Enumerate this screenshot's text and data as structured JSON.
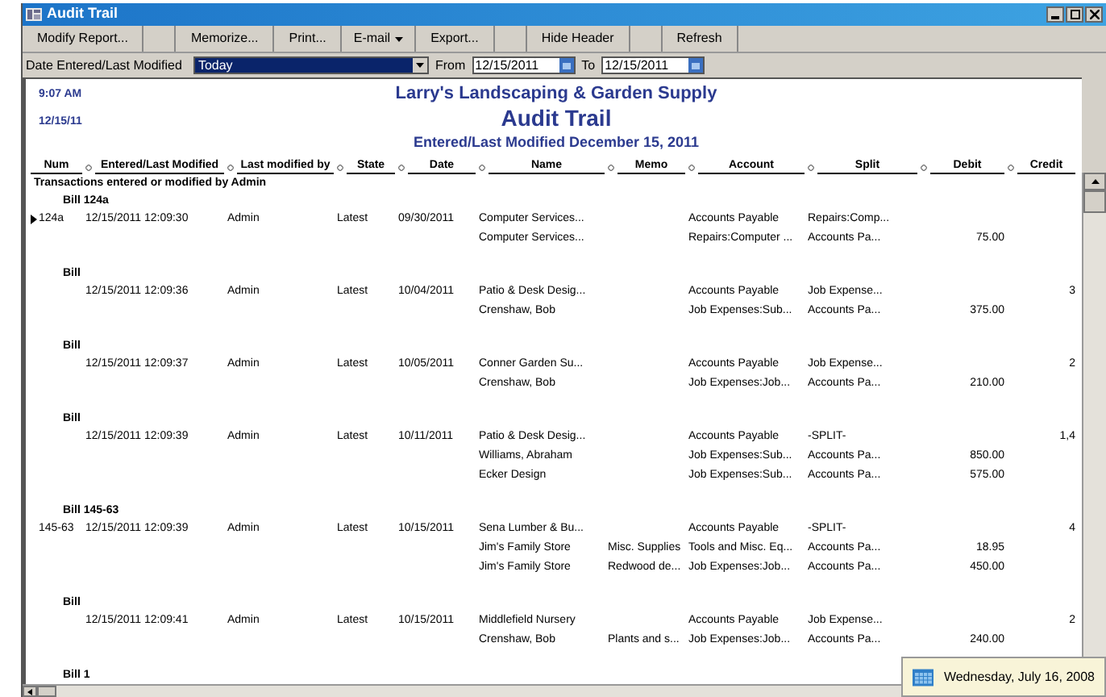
{
  "window": {
    "title": "Audit Trail"
  },
  "toolbar": [
    {
      "kind": "button",
      "label": "Modify Report..."
    },
    {
      "kind": "spacer"
    },
    {
      "kind": "button",
      "label": "Memorize..."
    },
    {
      "kind": "button",
      "label": "Print..."
    },
    {
      "kind": "menu",
      "label": "E-mail"
    },
    {
      "kind": "button",
      "label": "Export..."
    },
    {
      "kind": "spacer"
    },
    {
      "kind": "button",
      "label": "Hide Header"
    },
    {
      "kind": "spacer"
    },
    {
      "kind": "button",
      "label": "Refresh"
    }
  ],
  "filter": {
    "label": "Date Entered/Last Modified",
    "period": "Today",
    "from_label": "From",
    "from": "12/15/2011",
    "to_label": "To",
    "to": "12/15/2011"
  },
  "report": {
    "time": "9:07 AM",
    "date": "12/15/11",
    "company": "Larry's Landscaping & Garden Supply",
    "title": "Audit Trail",
    "subtitle": "Entered/Last Modified December 15, 2011",
    "columns": [
      "Num",
      "Entered/Last Modified",
      "Last modified by",
      "State",
      "Date",
      "Name",
      "Memo",
      "Account",
      "Split",
      "Debit",
      "Credit"
    ],
    "section": "Transactions entered or modified by Admin",
    "groups": [
      {
        "title": "Bill 124a",
        "lines": [
          {
            "selected": true,
            "num": "124a",
            "entered": "12/15/2011 12:09:30",
            "by": "Admin",
            "state": "Latest",
            "date": "09/30/2011",
            "name": "Computer Services...",
            "account": "Accounts Payable",
            "split": "Repairs:Comp..."
          },
          {
            "selected": false,
            "name": "Computer Services...",
            "account": "Repairs:Computer ...",
            "split": "Accounts Pa...",
            "debit": "75.00"
          }
        ]
      },
      {
        "title": "Bill",
        "lines": [
          {
            "selected": false,
            "entered": "12/15/2011 12:09:36",
            "by": "Admin",
            "state": "Latest",
            "date": "10/04/2011",
            "name": "Patio & Desk Desig...",
            "account": "Accounts Payable",
            "split": "Job Expense...",
            "credit": "3"
          },
          {
            "selected": false,
            "name": "Crenshaw, Bob",
            "account": "Job Expenses:Sub...",
            "split": "Accounts Pa...",
            "debit": "375.00"
          }
        ]
      },
      {
        "title": "Bill",
        "lines": [
          {
            "selected": false,
            "entered": "12/15/2011 12:09:37",
            "by": "Admin",
            "state": "Latest",
            "date": "10/05/2011",
            "name": "Conner Garden Su...",
            "account": "Accounts Payable",
            "split": "Job Expense...",
            "credit": "2"
          },
          {
            "selected": false,
            "name": "Crenshaw, Bob",
            "account": "Job Expenses:Job...",
            "split": "Accounts Pa...",
            "debit": "210.00"
          }
        ]
      },
      {
        "title": "Bill",
        "lines": [
          {
            "selected": false,
            "entered": "12/15/2011 12:09:39",
            "by": "Admin",
            "state": "Latest",
            "date": "10/11/2011",
            "name": "Patio & Desk Desig...",
            "account": "Accounts Payable",
            "split": "-SPLIT-",
            "credit": "1,4"
          },
          {
            "selected": false,
            "name": "Williams, Abraham",
            "account": "Job Expenses:Sub...",
            "split": "Accounts Pa...",
            "debit": "850.00"
          },
          {
            "selected": false,
            "name": "Ecker Design",
            "account": "Job Expenses:Sub...",
            "split": "Accounts Pa...",
            "debit": "575.00"
          }
        ]
      },
      {
        "title": "Bill 145-63",
        "lines": [
          {
            "selected": false,
            "num": "145-63",
            "entered": "12/15/2011 12:09:39",
            "by": "Admin",
            "state": "Latest",
            "date": "10/15/2011",
            "name": "Sena Lumber & Bu...",
            "account": "Accounts Payable",
            "split": "-SPLIT-",
            "credit": "4"
          },
          {
            "selected": false,
            "name": "Jim's Family Store",
            "memo": "Misc. Supplies",
            "account": "Tools and Misc. Eq...",
            "split": "Accounts Pa...",
            "debit": "18.95"
          },
          {
            "selected": false,
            "name": "Jim's Family Store",
            "memo": "Redwood de...",
            "account": "Job Expenses:Job...",
            "split": "Accounts Pa...",
            "debit": "450.00"
          }
        ]
      },
      {
        "title": "Bill",
        "lines": [
          {
            "selected": false,
            "entered": "12/15/2011 12:09:41",
            "by": "Admin",
            "state": "Latest",
            "date": "10/15/2011",
            "name": "Middlefield Nursery",
            "account": "Accounts Payable",
            "split": "Job Expense...",
            "credit": "2"
          },
          {
            "selected": false,
            "name": "Crenshaw, Bob",
            "memo": "Plants and s...",
            "account": "Job Expenses:Job...",
            "split": "Accounts Pa...",
            "debit": "240.00"
          }
        ]
      },
      {
        "title": "Bill 1"
      }
    ]
  },
  "tooltip": {
    "text": "Wednesday, July 16, 2008"
  }
}
